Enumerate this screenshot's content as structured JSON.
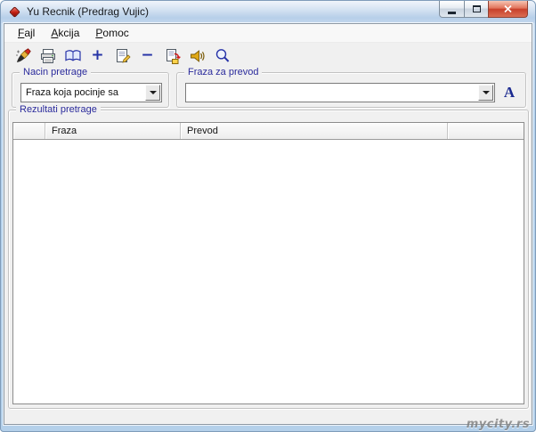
{
  "window": {
    "title": "Yu Recnik (Predrag Vujic)"
  },
  "menu": {
    "items": [
      {
        "first": "F",
        "rest": "ajl"
      },
      {
        "first": "A",
        "rest": "kcija"
      },
      {
        "first": "P",
        "rest": "omoc"
      }
    ]
  },
  "toolbar": {
    "buttons": [
      {
        "icon": "edit-pen-icon"
      },
      {
        "icon": "printer-icon"
      },
      {
        "icon": "open-book-icon"
      },
      {
        "icon": "add-icon",
        "glyph": "+"
      },
      {
        "icon": "notepad-edit-icon"
      },
      {
        "icon": "remove-icon",
        "glyph": "−"
      },
      {
        "icon": "save-export-icon"
      },
      {
        "icon": "speaker-icon"
      },
      {
        "icon": "search-icon"
      }
    ]
  },
  "search_mode": {
    "label": "Nacin pretrage",
    "selected": "Fraza koja pocinje sa"
  },
  "phrase": {
    "label": "Fraza za prevod",
    "value": "",
    "font_button_label": "A"
  },
  "results": {
    "label": "Rezultati pretrage",
    "columns": [
      "",
      "Fraza",
      "Prevod",
      ""
    ],
    "rows": []
  },
  "watermark": {
    "text": "mycity.rs"
  },
  "colors": {
    "titlebar": "#c3d7ed",
    "window_border": "#b4d0ea",
    "close_button": "#c8402a",
    "group_label": "#2b2b9c",
    "toolbar_glyph": "#2634a6"
  }
}
